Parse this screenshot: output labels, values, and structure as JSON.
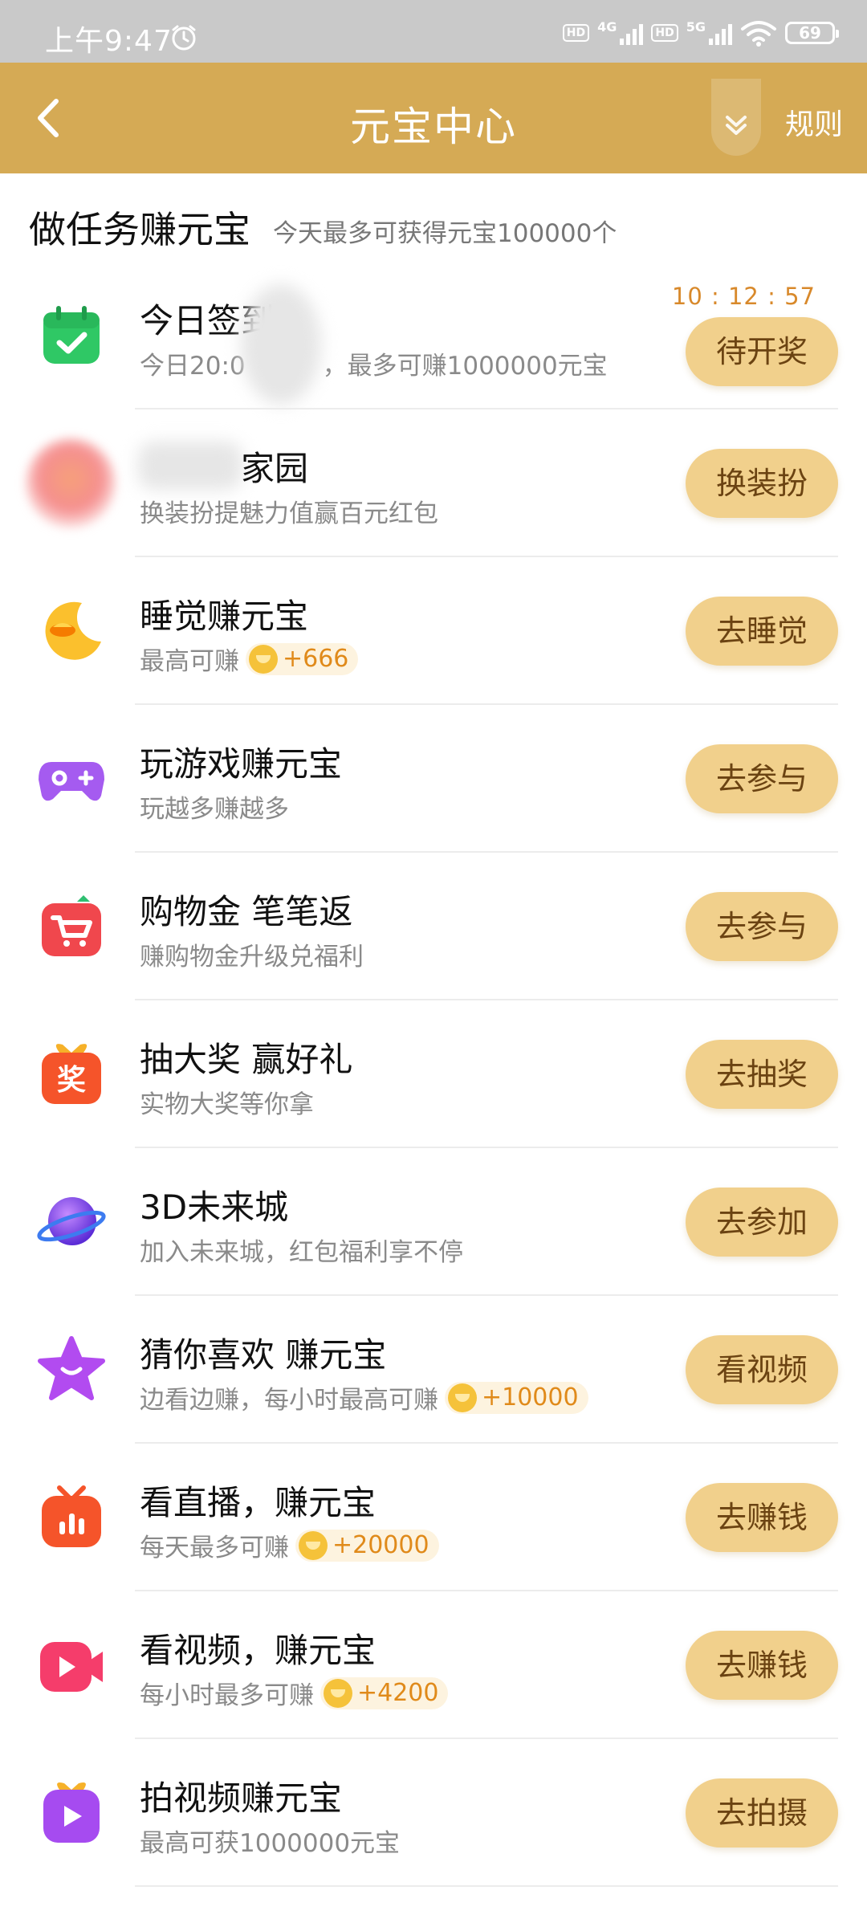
{
  "status_bar": {
    "time": "上午9:47",
    "network_1": "4G",
    "network_2": "5G",
    "hd": "HD",
    "battery": "69"
  },
  "header": {
    "title": "元宝中心",
    "rules": "规则",
    "background_color": "#d5aa55"
  },
  "section": {
    "title": "做任务赚元宝",
    "subtitle": "今天最多可获得元宝100000个"
  },
  "tasks": [
    {
      "icon": "calendar-check-icon",
      "title": "今日签到",
      "desc": "今日20:0",
      "desc_suffix": "，最多可赚1000000元宝",
      "button": "待开奖",
      "countdown": "10 : 12 : 57"
    },
    {
      "icon": "avatar-home-icon",
      "title": "家园",
      "desc": "换装扮提魅力值赢百元红包",
      "button": "换装扮"
    },
    {
      "icon": "moon-ingot-icon",
      "title": "睡觉赚元宝",
      "desc": "最高可赚",
      "reward": "+666",
      "button": "去睡觉"
    },
    {
      "icon": "gamepad-icon",
      "title": "玩游戏赚元宝",
      "desc": "玩越多赚越多",
      "button": "去参与"
    },
    {
      "icon": "shopping-cart-icon",
      "title": "购物金 笔笔返",
      "desc": "赚购物金升级兑福利",
      "button": "去参与"
    },
    {
      "icon": "prize-gift-icon",
      "title": "抽大奖 赢好礼",
      "desc": "实物大奖等你拿",
      "button": "去抽奖"
    },
    {
      "icon": "planet-icon",
      "title": "3D未来城",
      "desc": "加入未来城，红包福利享不停",
      "button": "去参加"
    },
    {
      "icon": "star-ingot-icon",
      "title": "猜你喜欢 赚元宝",
      "desc": "边看边赚，每小时最高可赚",
      "reward": "+10000",
      "button": "看视频"
    },
    {
      "icon": "live-tv-icon",
      "title": "看直播，赚元宝",
      "desc": "每天最多可赚",
      "reward": "+20000",
      "button": "去赚钱"
    },
    {
      "icon": "video-play-icon",
      "title": "看视频，赚元宝",
      "desc": "每小时最多可赚",
      "reward": "+4200",
      "button": "去赚钱"
    },
    {
      "icon": "video-shoot-icon",
      "title": "拍视频赚元宝",
      "desc": "最高可获1000000元宝",
      "button": "去拍摄"
    }
  ]
}
